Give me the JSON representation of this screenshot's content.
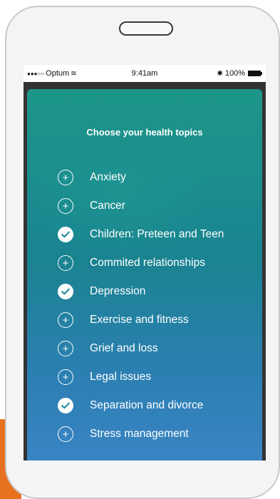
{
  "status_bar": {
    "carrier": "Optum",
    "time": "9:41am",
    "battery": "100%"
  },
  "panel": {
    "title": "Choose your health topics"
  },
  "topics": [
    {
      "label": "Anxiety",
      "checked": false
    },
    {
      "label": "Cancer",
      "checked": false
    },
    {
      "label": "Children: Preteen and Teen",
      "checked": true
    },
    {
      "label": "Commited relationships",
      "checked": false
    },
    {
      "label": "Depression",
      "checked": true
    },
    {
      "label": "Exercise and fitness",
      "checked": false
    },
    {
      "label": "Grief and loss",
      "checked": false
    },
    {
      "label": "Legal issues",
      "checked": false
    },
    {
      "label": "Separation and divorce",
      "checked": true
    },
    {
      "label": "Stress management",
      "checked": false
    }
  ],
  "colors": {
    "panel_top": "#1c9688",
    "panel_bottom": "#3a84c4",
    "accent_orange": "#e8711f",
    "check_color": "#2a8fa0"
  },
  "icons": {
    "unchecked": "plus-circle-icon",
    "checked": "check-circle-icon"
  }
}
